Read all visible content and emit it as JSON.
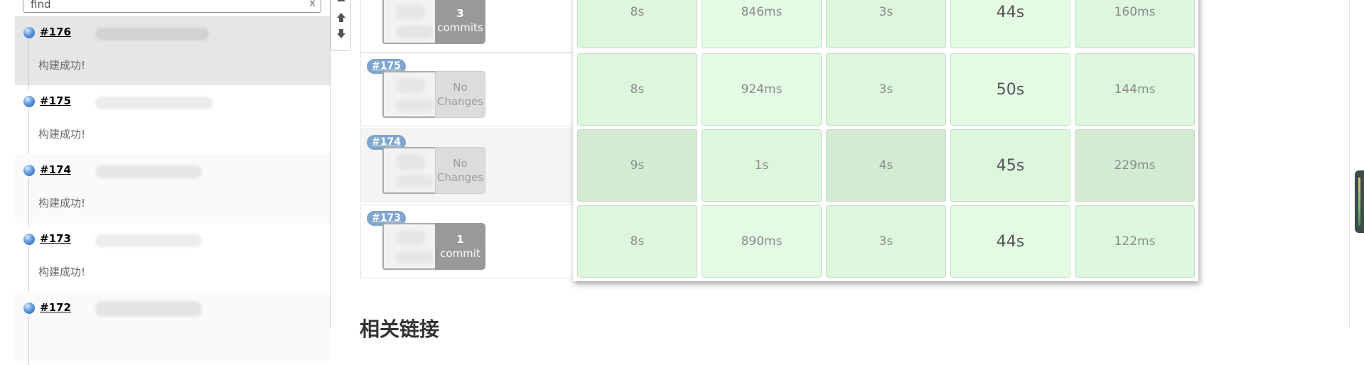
{
  "filter": {
    "value": "find",
    "clear_label": "x"
  },
  "history": [
    {
      "number": "#176",
      "status": "构建成功!"
    },
    {
      "number": "#175",
      "status": "构建成功!"
    },
    {
      "number": "#174",
      "status": "构建成功!"
    },
    {
      "number": "#173",
      "status": "构建成功!"
    },
    {
      "number": "#172",
      "status": ""
    }
  ],
  "scroll_arrows": [
    "arrow-up",
    "arrow-up",
    "arrow-down"
  ],
  "stage_builds": [
    {
      "badge": "",
      "changes_count": "3",
      "changes_text": "commits",
      "type": "commits",
      "durations": [
        "8s",
        "846ms",
        "3s",
        "44s",
        "160ms"
      ]
    },
    {
      "badge": "#175",
      "changes_count": "No",
      "changes_text": "Changes",
      "type": "none",
      "durations": [
        "8s",
        "924ms",
        "3s",
        "50s",
        "144ms"
      ]
    },
    {
      "badge": "#174",
      "changes_count": "No",
      "changes_text": "Changes",
      "type": "none",
      "durations": [
        "9s",
        "1s",
        "4s",
        "45s",
        "229ms"
      ]
    },
    {
      "badge": "#173",
      "changes_count": "1",
      "changes_text": "commit",
      "type": "commits",
      "durations": [
        "8s",
        "890ms",
        "3s",
        "44s",
        "122ms"
      ]
    }
  ],
  "section_heading": "相关链接",
  "colors": {
    "success_cell": "#e4fbe4",
    "badge": "#7fa5cc",
    "commits_box": "#999999"
  }
}
